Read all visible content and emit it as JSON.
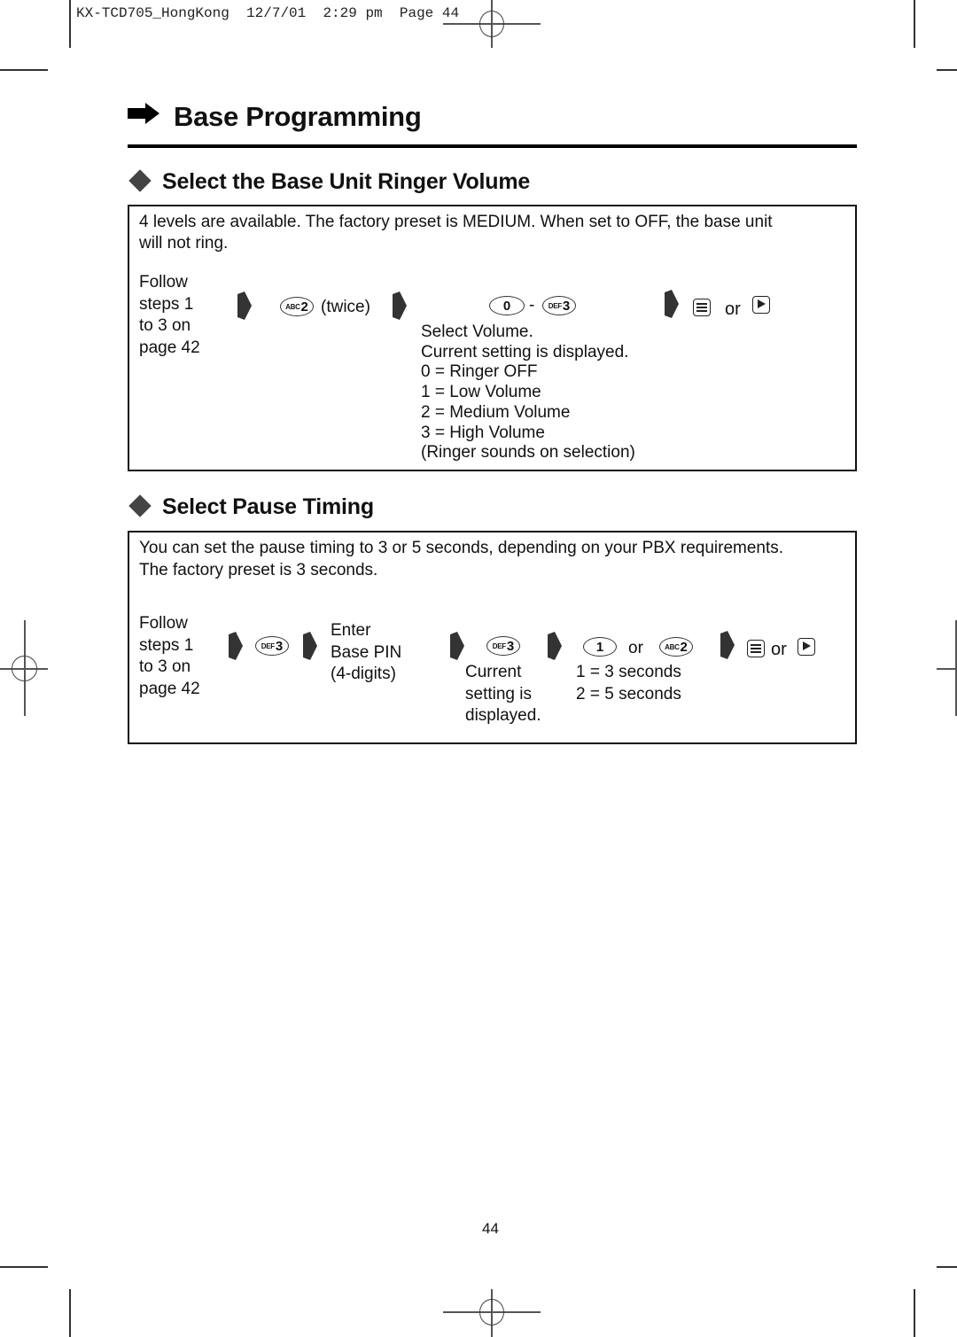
{
  "print_header": {
    "text": "KX-TCD705_HongKong  12/7/01  2:29 pm  Page 44"
  },
  "page_title": "Base Programming",
  "sections": [
    {
      "title": "Select the Base Unit Ringer Volume",
      "intro_line1": "4 levels are available. The factory preset is MEDIUM. When set to OFF, the base unit",
      "intro_line2": "will not ring.",
      "follow_text": "Follow\nsteps 1\nto 3 on\npage 42",
      "step1_key": {
        "sub": "ABC",
        "main": "2"
      },
      "step1_note": "(twice)",
      "step2_key_a": {
        "sub": "",
        "main": "0"
      },
      "step2_dash": "-",
      "step2_key_b": {
        "sub": "DEF",
        "main": "3"
      },
      "step2_desc": "Select Volume.\nCurrent setting is displayed.\n0 = Ringer OFF\n1 = Low Volume\n2 = Medium Volume\n3 = High Volume\n(Ringer sounds on selection)",
      "final_or": "or",
      "final_icons": [
        "menu-icon",
        "play-icon"
      ]
    },
    {
      "title": "Select Pause Timing",
      "intro_line1": "You can set the pause timing to 3 or 5 seconds, depending on your PBX requirements.",
      "intro_line2": "The factory preset is 3 seconds.",
      "follow_text": "Follow\nsteps 1\nto 3 on\npage 42",
      "step1_key": {
        "sub": "DEF",
        "main": "3"
      },
      "step2_text": "Enter\nBase PIN\n(4-digits)",
      "step3_key": {
        "sub": "DEF",
        "main": "3"
      },
      "step3_desc": "Current\nsetting is\ndisplayed.",
      "step4_key_a": {
        "sub": "",
        "main": "1"
      },
      "step4_or": "or",
      "step4_key_b": {
        "sub": "ABC",
        "main": "2"
      },
      "step4_desc": "1 = 3 seconds\n2 = 5 seconds",
      "final_or": "or",
      "final_icons": [
        "menu-icon",
        "play-icon"
      ]
    }
  ],
  "footer": {
    "page_number": "44"
  }
}
